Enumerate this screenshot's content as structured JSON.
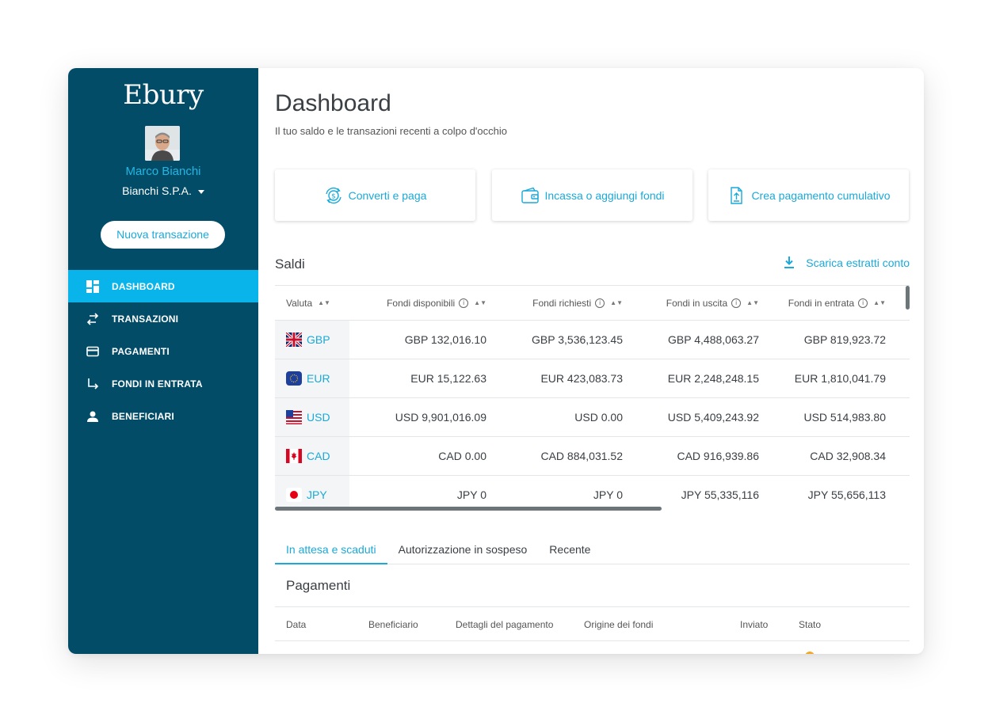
{
  "sidebar": {
    "logo": "Ebury",
    "user_name": "Marco Bianchi",
    "company": "Bianchi S.P.A.",
    "new_transaction": "Nuova transazione",
    "items": [
      {
        "label": "DASHBOARD",
        "icon": "dashboard-icon",
        "active": true
      },
      {
        "label": "TRANSAZIONI",
        "icon": "swap-arrows-icon",
        "active": false
      },
      {
        "label": "PAGAMENTI",
        "icon": "card-icon",
        "active": false
      },
      {
        "label": "FONDI IN ENTRATA",
        "icon": "arrow-down-right-icon",
        "active": false
      },
      {
        "label": "BENEFICIARI",
        "icon": "person-icon",
        "active": false
      }
    ]
  },
  "header": {
    "title": "Dashboard",
    "subtitle": "Il tuo saldo e le transazioni recenti a colpo d'occhio"
  },
  "actions": [
    {
      "label": "Converti e paga",
      "icon": "exchange-coin-icon"
    },
    {
      "label": "Incassa o aggiungi fondi",
      "icon": "wallet-icon"
    },
    {
      "label": "Crea pagamento cumulativo",
      "icon": "upload-file-icon"
    }
  ],
  "balances": {
    "title": "Saldi",
    "download_label": "Scarica estratti conto",
    "columns": [
      "Valuta",
      "Fondi disponibili",
      "Fondi richiesti",
      "Fondi in uscita",
      "Fondi in entrata"
    ],
    "rows": [
      {
        "currency": "GBP",
        "flag": "uk-flag-icon",
        "available": "GBP 132,016.10",
        "requested": "GBP 3,536,123.45",
        "outgoing": "GBP 4,488,063.27",
        "incoming": "GBP 819,923.72"
      },
      {
        "currency": "EUR",
        "flag": "eu-flag-icon",
        "available": "EUR 15,122.63",
        "requested": "EUR 423,083.73",
        "outgoing": "EUR 2,248,248.15",
        "incoming": "EUR 1,810,041.79"
      },
      {
        "currency": "USD",
        "flag": "us-flag-icon",
        "available": "USD 9,901,016.09",
        "requested": "USD 0.00",
        "outgoing": "USD 5,409,243.92",
        "incoming": "USD 514,983.80"
      },
      {
        "currency": "CAD",
        "flag": "canada-flag-icon",
        "available": "CAD 0.00",
        "requested": "CAD 884,031.52",
        "outgoing": "CAD 916,939.86",
        "incoming": "CAD 32,908.34"
      },
      {
        "currency": "JPY",
        "flag": "japan-flag-icon",
        "available": "JPY 0",
        "requested": "JPY 0",
        "outgoing": "JPY 55,335,116",
        "incoming": "JPY 55,656,113"
      }
    ]
  },
  "tabs": [
    "In attesa e scaduti",
    "Autorizzazione in sospeso",
    "Recente"
  ],
  "payments": {
    "title": "Pagamenti",
    "columns": [
      "Data",
      "Beneficiario",
      "Dettagli del pagamento",
      "Origine dei fondi",
      "Inviato",
      "Stato"
    ]
  },
  "colors": {
    "sidebar_bg": "#034c68",
    "accent": "#08b4ea",
    "link": "#1aa9d8"
  }
}
